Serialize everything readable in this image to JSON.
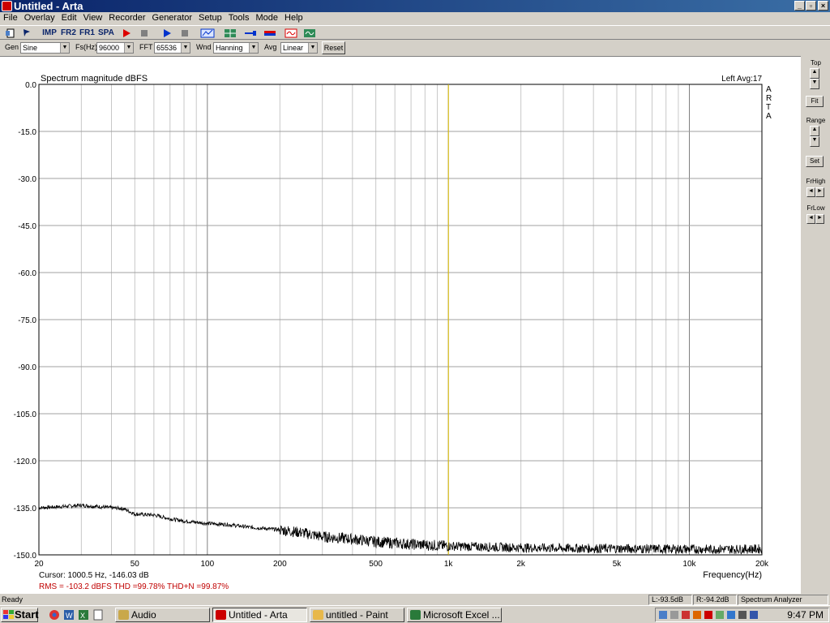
{
  "window": {
    "title": "Untitled - Arta",
    "minimize": "_",
    "restore": "▫",
    "close": "×"
  },
  "menu": [
    "File",
    "Overlay",
    "Edit",
    "View",
    "Recorder",
    "Generator",
    "Setup",
    "Tools",
    "Mode",
    "Help"
  ],
  "toolbar": {
    "imp": "IMP",
    "fr2": "FR2",
    "fr1": "FR1",
    "spa": "SPA"
  },
  "controls": {
    "gen_label": "Gen",
    "gen_value": "Sine",
    "fs_label": "Fs(Hz)",
    "fs_value": "96000",
    "fft_label": "FFT",
    "fft_value": "65536",
    "wnd_label": "Wnd",
    "wnd_value": "Hanning",
    "avg_label": "Avg",
    "avg_value": "Linear",
    "reset_label": "Reset"
  },
  "right_panel": {
    "top": "Top",
    "fit": "Fit",
    "range": "Range",
    "set": "Set",
    "frhigh": "FrHigh",
    "frlow": "FrLow"
  },
  "chart_data": {
    "type": "line",
    "title": "Spectrum magnitude dBFS",
    "channel_info": "Left  Avg:17",
    "brand": [
      "A",
      "R",
      "T",
      "A"
    ],
    "xlabel": "Frequency(Hz)",
    "xscale": "log",
    "xlim": [
      20,
      20000
    ],
    "ylim": [
      -150,
      0
    ],
    "yticks": [
      0,
      -15,
      -30,
      -45,
      -60,
      -75,
      -90,
      -105,
      -120,
      -135,
      -150
    ],
    "ytick_labels": [
      "0.0",
      "-15.0",
      "-30.0",
      "-45.0",
      "-60.0",
      "-75.0",
      "-90.0",
      "-105.0",
      "-120.0",
      "-135.0",
      "-150.0"
    ],
    "xticks": [
      20,
      50,
      100,
      200,
      500,
      1000,
      2000,
      5000,
      10000,
      20000
    ],
    "xtick_labels": [
      "20",
      "50",
      "100",
      "200",
      "500",
      "1k",
      "2k",
      "5k",
      "10k",
      "20k"
    ],
    "grid": true,
    "cursor_x": 1000.5,
    "series": [
      {
        "color": "#000000",
        "x": [
          20,
          25,
          30,
          35,
          40,
          45,
          50,
          60,
          70,
          80,
          90,
          100,
          120,
          150,
          200,
          250,
          300,
          400,
          500,
          700,
          1000,
          1500,
          2000,
          3000,
          5000,
          7000,
          10000,
          15000,
          20000
        ],
        "y": [
          -135,
          -134.6,
          -134.2,
          -134.6,
          -135,
          -135.3,
          -137,
          -137.3,
          -138.5,
          -139.2,
          -139.6,
          -140,
          -140.3,
          -141.2,
          -142,
          -143,
          -144.2,
          -145,
          -145.8,
          -146.6,
          -147.2,
          -147.5,
          -147.7,
          -147.9,
          -148,
          -148.1,
          -148.2,
          -148.2,
          -148.1
        ]
      }
    ],
    "cursor_text": "Cursor:  1000.5 Hz, -146.03 dB",
    "stats_text": "RMS = -103.2 dBFS   THD =99.78%   THD+N =99.87%"
  },
  "status": {
    "ready": "Ready",
    "left": "L:-93.5dB",
    "right": "R:-94.2dB",
    "mode": "Spectrum Analyzer"
  },
  "taskbar": {
    "start": "Start",
    "tasks": [
      "Audio",
      "Untitled - Arta",
      "untitled - Paint",
      "Microsoft Excel ..."
    ],
    "clock": "9:47 PM"
  }
}
